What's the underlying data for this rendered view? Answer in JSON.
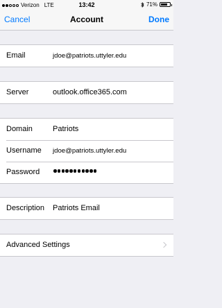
{
  "status_bar": {
    "carrier": "Verizon",
    "network": "LTE",
    "time": "13:42",
    "battery_text": "71%",
    "battery_level": 0.71,
    "signal_bars_filled": 2,
    "signal_bars_total": 5
  },
  "nav": {
    "cancel_label": "Cancel",
    "title": "Account",
    "done_label": "Done"
  },
  "fields": {
    "email_label": "Email",
    "email_value": "jdoe@patriots.uttyler.edu",
    "server_label": "Server",
    "server_value": "outlook.office365.com",
    "domain_label": "Domain",
    "domain_value": "Patriots",
    "username_label": "Username",
    "username_value": "jdoe@patriots.uttyler.edu",
    "password_label": "Password",
    "password_length": 11,
    "description_label": "Description",
    "description_value": "Patriots Email",
    "advanced_label": "Advanced Settings"
  },
  "colors": {
    "accent": "#007aff",
    "background": "#efeff4",
    "separator": "#c8c7cc"
  }
}
